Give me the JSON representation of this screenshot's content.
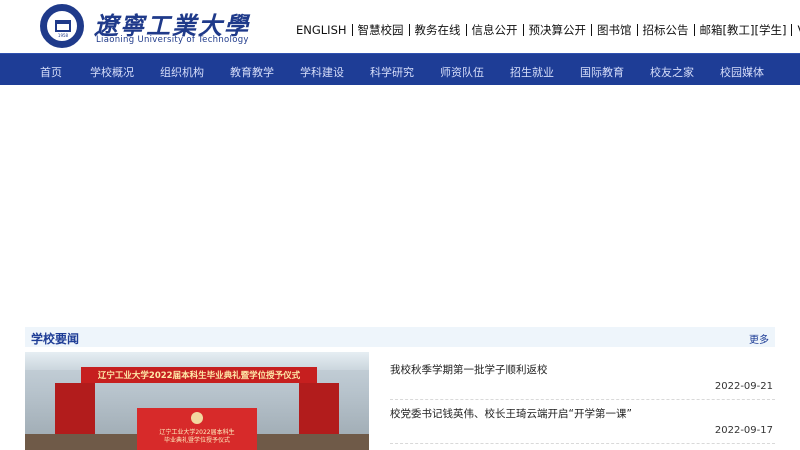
{
  "header": {
    "logo_cn": "遼寧工業大學",
    "logo_en": "Liaoning University of Technology",
    "emblem_year": "1958",
    "toplinks": [
      "ENGLISH",
      "智慧校园",
      "教务在线",
      "信息公开",
      "预决算公开",
      "图书馆",
      "招标公告",
      "邮箱[教工][学生]",
      "VPN"
    ]
  },
  "nav": {
    "items": [
      "首页",
      "学校概况",
      "组织机构",
      "教育教学",
      "学科建设",
      "科学研究",
      "师资队伍",
      "招生就业",
      "国际教育",
      "校友之家",
      "校园媒体"
    ]
  },
  "news": {
    "title": "学校要闻",
    "more": "更多",
    "photo": {
      "banner_text": "辽宁工业大学2022届本科生毕业典礼暨学位授予仪式",
      "screen_line1": "辽宁工业大学2022届本科生",
      "screen_line2": "毕业典礼暨学位授予仪式"
    },
    "items": [
      {
        "title": "我校秋季学期第一批学子顺利返校",
        "date": "2022-09-21"
      },
      {
        "title": "校党委书记钱英伟、校长王琦云端开启“开学第一课”",
        "date": "2022-09-17"
      }
    ]
  },
  "colors": {
    "brand_blue": "#1e3d96",
    "accent_red": "#c61f1f"
  }
}
